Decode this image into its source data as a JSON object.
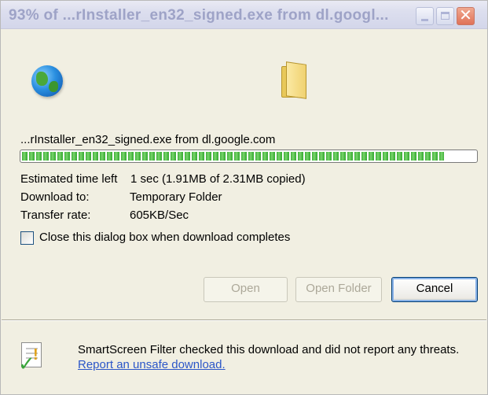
{
  "window": {
    "title": "93% of ...rInstaller_en32_signed.exe from dl.googl...",
    "buttons": {
      "minimize": "_",
      "maximize": "□",
      "close": "✕"
    }
  },
  "download": {
    "source": "...rInstaller_en32_signed.exe from dl.google.com",
    "progress_percent": 93,
    "time_left_label": "Estimated time left",
    "time_left_value": "1 sec (1.91MB of 2.31MB copied)",
    "download_to_label": "Download to:",
    "download_to_value": "Temporary Folder",
    "transfer_rate_label": "Transfer rate:",
    "transfer_rate_value": "605KB/Sec",
    "close_on_complete_label": "Close this dialog box when download completes",
    "close_on_complete_checked": false
  },
  "actions": {
    "open": "Open",
    "open_folder": "Open Folder",
    "cancel": "Cancel"
  },
  "smartscreen": {
    "message": "SmartScreen Filter checked this download and did not report any threats.",
    "link": "Report an unsafe download."
  },
  "icons": {
    "globe": "globe-icon",
    "folder": "folder-icon",
    "shield": "smartscreen-icon"
  },
  "colors": {
    "progress_fill": "#3fb03a",
    "link": "#2b56c8",
    "title_inactive": "#9ea3c7"
  }
}
